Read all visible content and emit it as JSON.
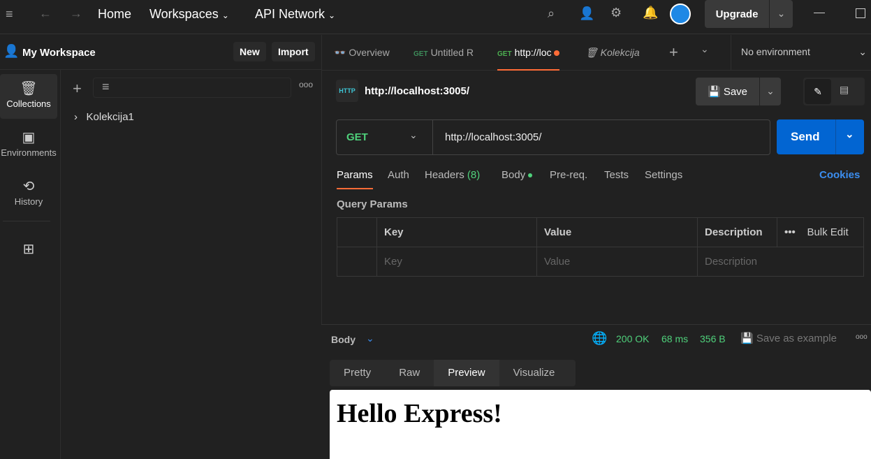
{
  "topbar": {
    "home": "Home",
    "workspaces": "Workspaces",
    "api_network": "API Network",
    "upgrade": "Upgrade"
  },
  "workspace": {
    "name": "My Workspace",
    "new": "New",
    "import": "Import"
  },
  "rail": [
    {
      "label": "Collections"
    },
    {
      "label": "Environments"
    },
    {
      "label": "History"
    }
  ],
  "collections": [
    {
      "name": "Kolekcija1"
    }
  ],
  "tabs": [
    {
      "label": "Overview"
    },
    {
      "method": "GET",
      "label": "Untitled R"
    },
    {
      "method": "GET",
      "label": "http://loc"
    },
    {
      "label": "Kolekcija"
    }
  ],
  "environment": "No environment",
  "request": {
    "title": "http://localhost:3005/",
    "method": "GET",
    "url": "http://localhost:3005/",
    "save": "Save",
    "send": "Send"
  },
  "subtabs": {
    "params": "Params",
    "auth": "Auth",
    "headers": "Headers",
    "headers_count": "(8)",
    "body": "Body",
    "prereq": "Pre-req.",
    "tests": "Tests",
    "settings": "Settings",
    "cookies": "Cookies"
  },
  "query": {
    "title": "Query Params",
    "headers": [
      "Key",
      "Value",
      "Description"
    ],
    "bulk": "Bulk Edit",
    "placeholders": [
      "Key",
      "Value",
      "Description"
    ]
  },
  "response": {
    "label": "Body",
    "status": "200 OK",
    "time": "68 ms",
    "size": "356 B",
    "save_example": "Save as example",
    "formats": [
      "Pretty",
      "Raw",
      "Preview",
      "Visualize"
    ],
    "preview_heading": "Hello Express!"
  },
  "colors": {
    "accent": "#ff6c37",
    "send": "#0265d2",
    "success": "#4fd17b"
  }
}
